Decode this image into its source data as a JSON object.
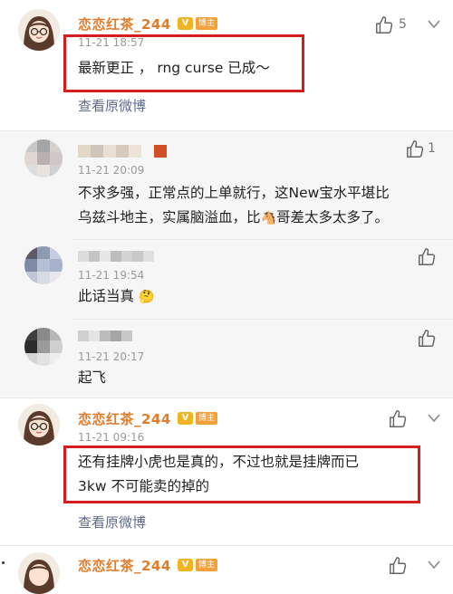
{
  "comments": [
    {
      "name": "恋恋红茶_244",
      "badge": "博主",
      "time": "11-21 18:57",
      "text": "最新更正 ， rng curse 已成～",
      "likes": "5",
      "link": "查看原微博"
    },
    {
      "time": "11-21 20:09",
      "text_lines": [
        "不求多强，正常点的上单就行，这New宝水平堪比",
        "乌兹斗地主，实属脑溢血，比",
        "哥差太多太多了。"
      ],
      "emoji": "🐴"
    },
    {
      "time": "11-21 19:54",
      "text": "此话当真",
      "emoji": "🤔"
    },
    {
      "time": "11-21 20:17",
      "text": "起飞"
    },
    {
      "name": "恋恋红茶_244",
      "badge": "博主",
      "time": "11-21 09:16",
      "text_lines": [
        "还有挂牌小虎也是真的，不过也就是挂牌而已",
        "3kw 不可能卖的掉的"
      ],
      "link": "查看原微博"
    },
    {
      "name": "恋恋红茶_244",
      "badge": "博主"
    }
  ],
  "colors": {
    "name": "#e07d2c",
    "accent_red": "#d51d1d",
    "link": "#5b6b8c"
  },
  "icons": {
    "like": "thumbs-up-icon",
    "verified": "v-badge-icon"
  }
}
